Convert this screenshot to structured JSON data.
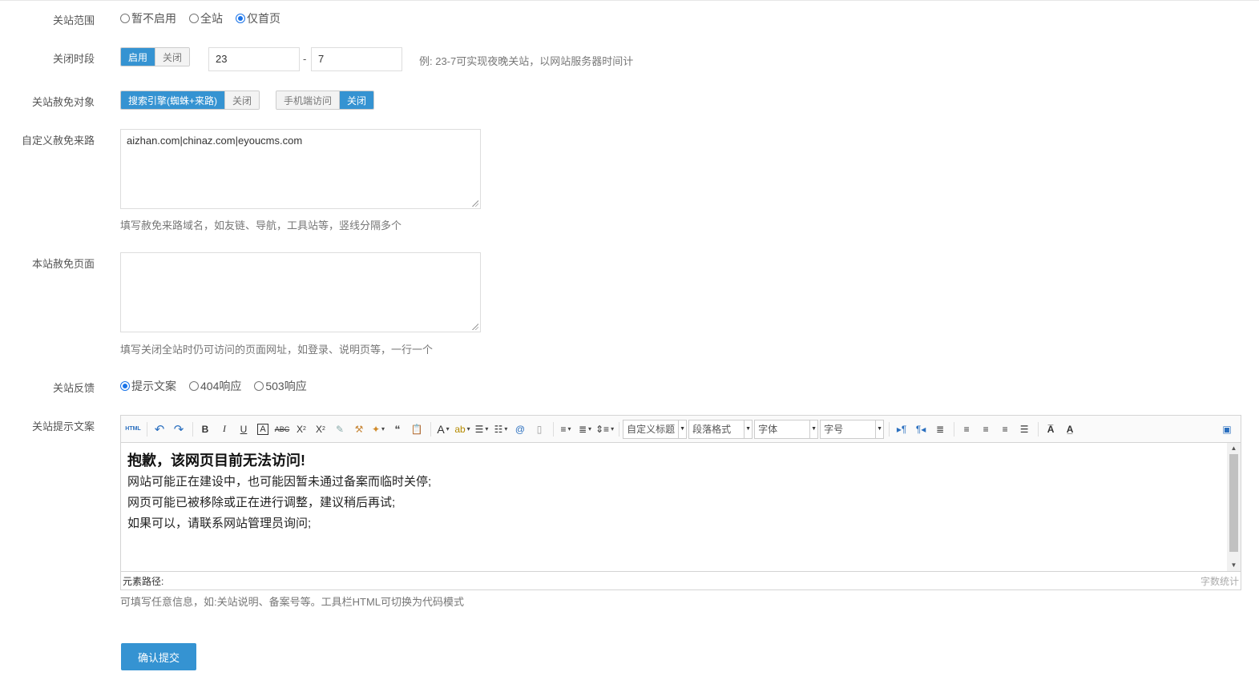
{
  "fields": {
    "close_scope": {
      "label": "关站范围",
      "options": [
        {
          "label": "暂不启用",
          "checked": false
        },
        {
          "label": "全站",
          "checked": false
        },
        {
          "label": "仅首页",
          "checked": true
        }
      ]
    },
    "close_period": {
      "label": "关闭时段",
      "toggle": {
        "on": "启用",
        "off": "关闭",
        "active": "on"
      },
      "start": "23",
      "separator": "-",
      "end": "7",
      "hint": "例: 23-7可实现夜晚关站，以网站服务器时间计"
    },
    "exempt_targets": {
      "label": "关站赦免对象",
      "search_engine": {
        "on": "搜索引擎(蜘蛛+来路)",
        "off": "关闭",
        "active": "on"
      },
      "mobile": {
        "on": "手机端访问",
        "off": "关闭",
        "active": "off"
      }
    },
    "custom_referrers": {
      "label": "自定义赦免来路",
      "value": "aizhan.com|chinaz.com|eyoucms.com",
      "hint": "填写赦免来路域名，如友链、导航，工具站等，竖线分隔多个"
    },
    "exempt_pages": {
      "label": "本站赦免页面",
      "value": "",
      "hint": "填写关闭全站时仍可访问的页面网址，如登录、说明页等，一行一个"
    },
    "feedback": {
      "label": "关站反馈",
      "options": [
        {
          "label": "提示文案",
          "checked": true
        },
        {
          "label": "404响应",
          "checked": false
        },
        {
          "label": "503响应",
          "checked": false
        }
      ]
    },
    "notice": {
      "label": "关站提示文案",
      "toolbar": {
        "html": "HTML",
        "custom_heading": "自定义标题",
        "paragraph": "段落格式",
        "font": "字体",
        "font_size": "字号"
      },
      "content": {
        "heading": "抱歉，该网页目前无法访问!",
        "lines": [
          "网站可能正在建设中，也可能因暂未通过备案而临时关停;",
          "网页可能已被移除或正在进行调整，建议稍后再试;",
          "如果可以，请联系网站管理员询问;"
        ]
      },
      "element_path": "元素路径:",
      "word_count": "字数统计",
      "hint": "可填写任意信息，如:关站说明、备案号等。工具栏HTML可切换为代码模式"
    }
  },
  "submit_label": "确认提交",
  "colors": {
    "accent": "#3593d2",
    "radio": "#1a73e8"
  }
}
